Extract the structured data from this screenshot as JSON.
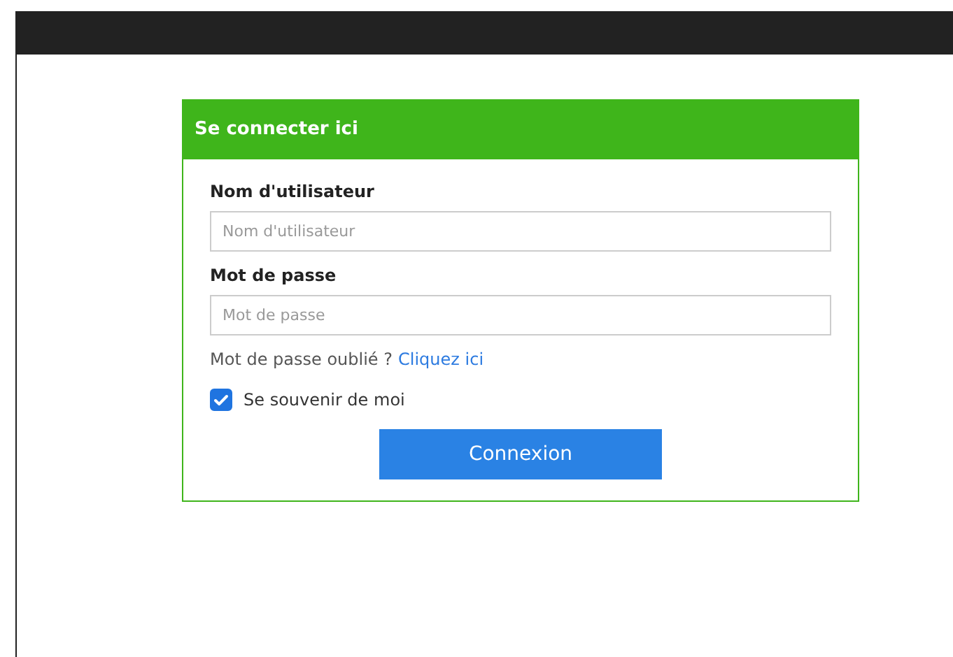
{
  "login_panel": {
    "title": "Se connecter ici",
    "fields": [
      {
        "label": "Nom d'utilisateur",
        "placeholder": "Nom d'utilisateur"
      },
      {
        "label": "Mot de passe",
        "placeholder": "Mot de passe"
      }
    ],
    "forgot": {
      "text": "Mot de passe oublié ?",
      "link": "Cliquez ici"
    },
    "remember": {
      "label": "Se souvenir de moi",
      "checked": true
    },
    "submit": "Connexion"
  }
}
